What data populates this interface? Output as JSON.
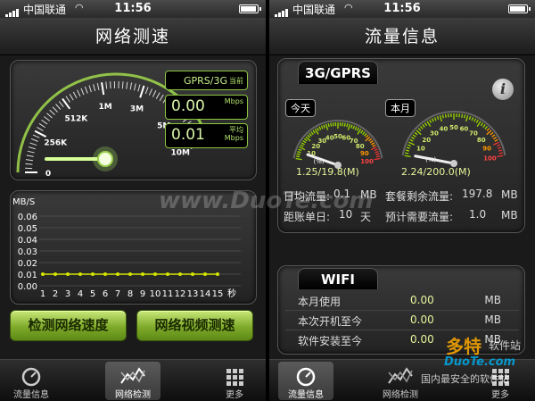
{
  "status": {
    "carrier": "中国联通",
    "time": "11:56"
  },
  "left": {
    "title": "网络测速",
    "gauge": {
      "ticks": [
        "0",
        "256K",
        "512K",
        "1M",
        "3M",
        "5M",
        "10M"
      ],
      "mode": "GPRS/3G",
      "mode_suffix": "当前",
      "current_value": "0.00",
      "current_unit": "Mbps",
      "average_value": "0.01",
      "average_label": "平均",
      "average_unit": "Mbps"
    },
    "chart": {
      "y_unit": "MB/S",
      "y_ticks": [
        "0.06",
        "0.05",
        "0.04",
        "0.03",
        "0.02",
        "0.01",
        "0.00"
      ],
      "x_ticks": [
        "1",
        "2",
        "3",
        "4",
        "5",
        "6",
        "7",
        "8",
        "9",
        "10",
        "11",
        "12",
        "13",
        "14",
        "15"
      ],
      "x_unit": "秒",
      "values": [
        0.01,
        0.01,
        0.01,
        0.01,
        0.01,
        0.01,
        0.01,
        0.01,
        0.01,
        0.01,
        0.01,
        0.01,
        0.01,
        0.01,
        0.01
      ],
      "ylim": [
        0,
        0.06
      ],
      "line_color": "#d4e600"
    },
    "buttons": {
      "test_speed": "检测网络速度",
      "test_video": "网络视频测速"
    },
    "tabs": [
      {
        "label": "流量信息",
        "icon": "gauge-icon",
        "active": false
      },
      {
        "label": "网络检测",
        "icon": "chart-icon",
        "active": true
      },
      {
        "label": "更多",
        "icon": "grid-icon",
        "active": false
      }
    ]
  },
  "right": {
    "title": "流量信息",
    "gprs": {
      "tab_label": "3G/GPRS",
      "today_label": "今天",
      "today_gauge": {
        "ticks": [
          "10",
          "20",
          "30",
          "40",
          "50",
          "60",
          "70",
          "80",
          "90",
          "100"
        ],
        "pct_label": "(%)",
        "fraction": 0.063
      },
      "today_value": "1.25/19.8(M)",
      "month_label": "本月",
      "month_gauge": {
        "ticks": [
          "10",
          "20",
          "30",
          "40",
          "50",
          "60",
          "70",
          "80",
          "90",
          "100"
        ],
        "pct_label": "(%)",
        "fraction": 0.011
      },
      "month_value": "2.24/200.0(M)",
      "daily_avg_label": "日均流量:",
      "daily_avg_value": "0.1",
      "daily_avg_unit": "MB",
      "remaining_label": "套餐剩余流量:",
      "remaining_value": "197.8",
      "remaining_unit": "MB",
      "days_label": "距账单日:",
      "days_value": "10",
      "days_unit": "天",
      "estimate_label": "预计需要流量:",
      "estimate_value": "1.0",
      "estimate_unit": "MB"
    },
    "wifi": {
      "tab_label": "WIFI",
      "rows": [
        {
          "label": "本月使用",
          "value": "0.00",
          "unit": "MB"
        },
        {
          "label": "本次开机至今",
          "value": "0.00",
          "unit": "MB"
        },
        {
          "label": "软件安装至今",
          "value": "0.00",
          "unit": "MB"
        }
      ]
    },
    "tabs": [
      {
        "label": "流量信息",
        "icon": "gauge-icon",
        "active": true
      },
      {
        "label": "网络检测",
        "icon": "chart-icon",
        "active": false
      },
      {
        "label": "更多",
        "icon": "grid-icon",
        "active": false
      }
    ]
  },
  "watermarks": {
    "main": "www.DuoTe.com",
    "brand": "多特",
    "brand_suffix": "软件站",
    "brand_url": "DuoTe.com",
    "slogan": "国内最安全的软件站"
  }
}
